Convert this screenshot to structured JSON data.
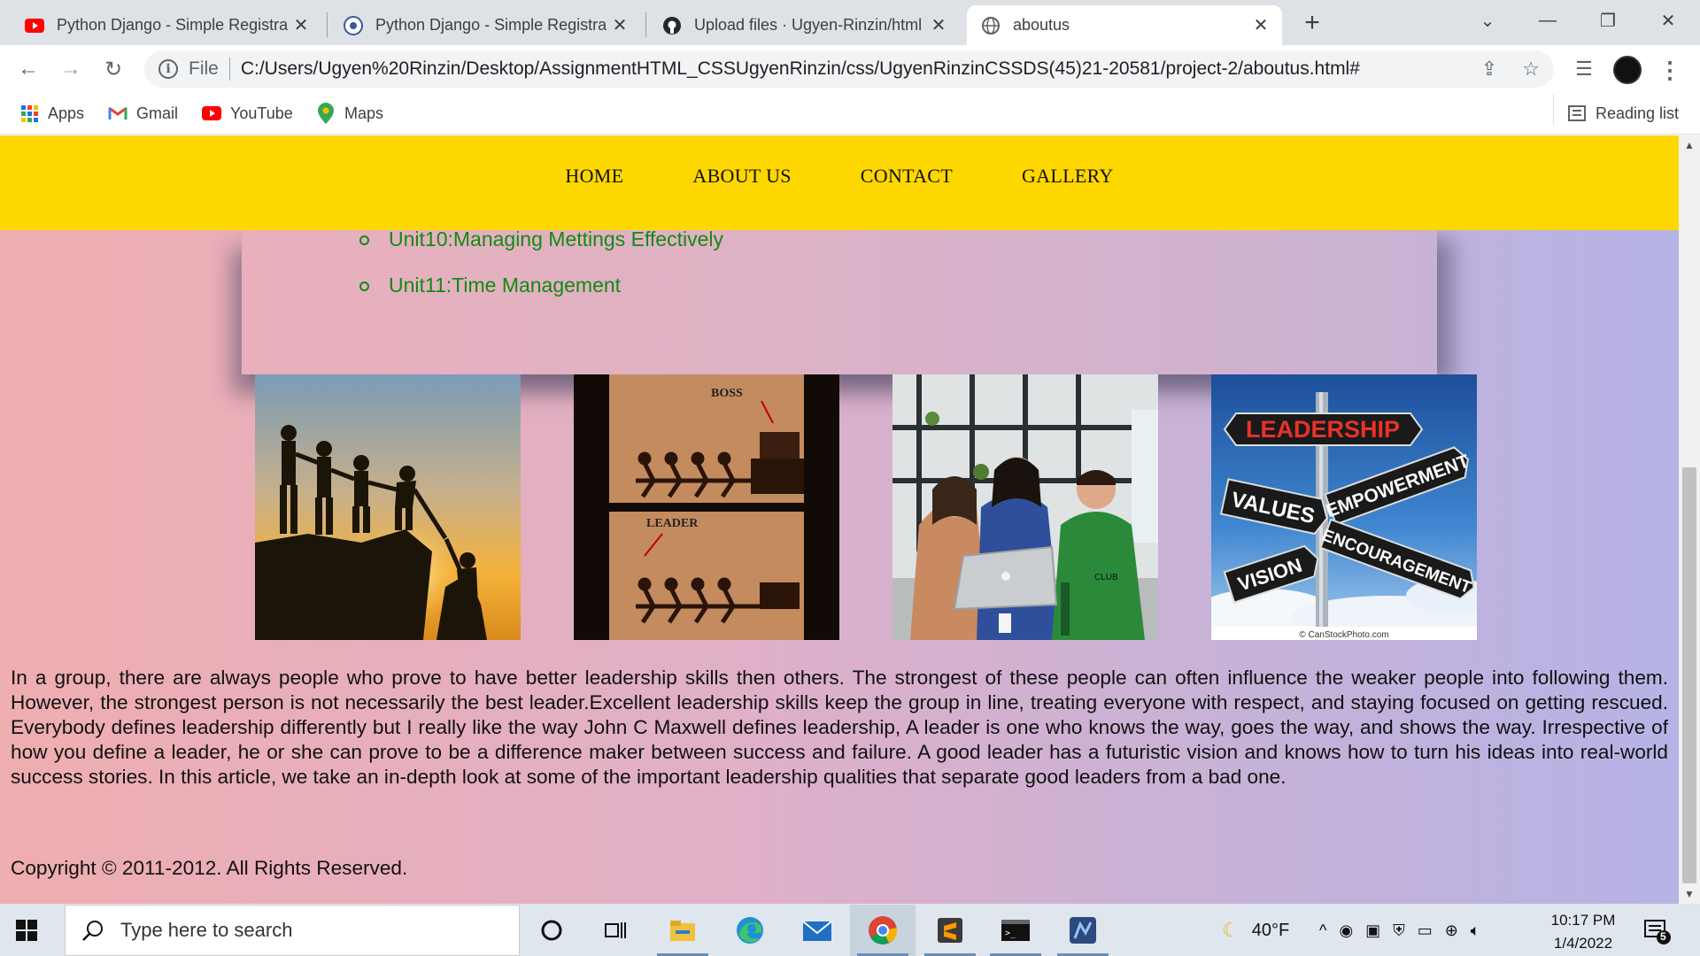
{
  "browser": {
    "tabs": [
      {
        "title": "Python Django - Simple Registra",
        "icon": "youtube-icon",
        "active": false
      },
      {
        "title": "Python Django - Simple Registra",
        "icon": "django-icon",
        "active": false
      },
      {
        "title": "Upload files · Ugyen-Rinzin/html",
        "icon": "github-icon",
        "active": false
      },
      {
        "title": "aboutus",
        "icon": "globe-icon",
        "active": true
      }
    ],
    "new_tab": "+",
    "address": {
      "scheme_label": "File",
      "url": "C:/Users/Ugyen%20Rinzin/Desktop/AssignmentHTML_CSSUgyenRinzin/css/UgyenRinzinCSSDS(45)21-20581/project-2/aboutus.html#"
    },
    "bookmarks": [
      {
        "label": "Apps",
        "icon": "apps-grid-icon"
      },
      {
        "label": "Gmail",
        "icon": "gmail-icon"
      },
      {
        "label": "YouTube",
        "icon": "youtube-icon"
      },
      {
        "label": "Maps",
        "icon": "maps-pin-icon"
      }
    ],
    "reading_list": "Reading list"
  },
  "page": {
    "nav": [
      "HOME",
      "ABOUT US",
      "CONTACT",
      "GALLERY"
    ],
    "units": [
      "Unit10:Managing Mettings Effectively",
      "Unit11:Time Management"
    ],
    "photos": [
      {
        "name": "teamwork-silhouette-photo"
      },
      {
        "name": "boss-vs-leader-photo",
        "captions": [
          "BOSS",
          "LEADER"
        ]
      },
      {
        "name": "team-laptop-photo",
        "captions": [
          "CLUB"
        ]
      },
      {
        "name": "leadership-signpost-photo",
        "captions": [
          "LEADERSHIP",
          "VALUES",
          "EMPOWERMENT",
          "ENCOURAGEMENT",
          "VISION",
          "© CanStockPhoto.com"
        ]
      }
    ],
    "paragraph": "In a group, there are always people who prove to have better leadership skills then others. The strongest of these people can often influence the weaker people into following them. However, the strongest person is not necessarily the best leader.Excellent leadership skills keep the group in line, treating everyone with respect, and staying focused on getting rescued. Everybody defines leadership differently but I really like the way John C Maxwell defines leadership, A leader is one who knows the way, goes the way, and shows the way. Irrespective of how you define a leader, he or she can prove to be a difference maker between success and failure. A good leader has a futuristic vision and knows how to turn his ideas into real-world success stories. In this article, we take an in-depth look at some of the important leadership qualities that separate good leaders from a bad one.",
    "copyright": "Copyright © 2011-2012. All Rights Reserved."
  },
  "taskbar": {
    "search_placeholder": "Type here to search",
    "weather": "40°F",
    "time": "10:17 PM",
    "date": "1/4/2022",
    "notifications": "5"
  },
  "colors": {
    "nav_bg": "#ffd700",
    "unit_text": "#138a13",
    "accent": "#1a73e8"
  }
}
